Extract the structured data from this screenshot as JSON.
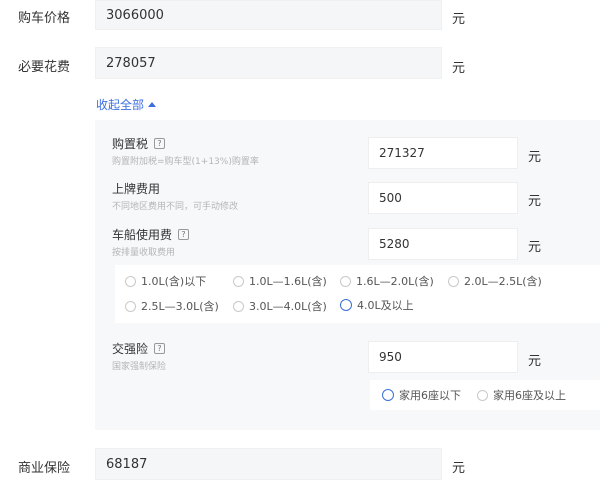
{
  "purchase_price": {
    "label": "购车价格",
    "value": "3066000",
    "unit": "元"
  },
  "required_fees": {
    "label": "必要花费",
    "value": "278057",
    "unit": "元"
  },
  "collapse_link": {
    "label": "收起全部"
  },
  "purchase_tax": {
    "label": "购置税",
    "hint": "购置附加税=购车型(1+13%)购置率",
    "value": "271327",
    "unit": "元"
  },
  "plate_fee": {
    "label": "上牌费用",
    "hint": "不同地区费用不同，可手动修改",
    "value": "500",
    "unit": "元"
  },
  "vessel_tax": {
    "label": "车船使用费",
    "hint": "按排量收取费用",
    "value": "5280",
    "unit": "元",
    "options": [
      "1.0L(含)以下",
      "1.0L—1.6L(含)",
      "1.6L—2.0L(含)",
      "2.0L—2.5L(含)",
      "2.5L—3.0L(含)",
      "3.0L—4.0L(含)",
      "4.0L及以上"
    ],
    "selected": "4.0L及以上"
  },
  "compulsory_insurance": {
    "label": "交强险",
    "hint": "国家强制保险",
    "value": "950",
    "unit": "元",
    "options": [
      "家用6座以下",
      "家用6座及以上"
    ],
    "selected": "家用6座以下"
  },
  "commercial_insurance": {
    "label": "商业保险",
    "value": "68187",
    "unit": "元"
  },
  "help_glyph": "?",
  "accent_color": "#3d6ee0"
}
